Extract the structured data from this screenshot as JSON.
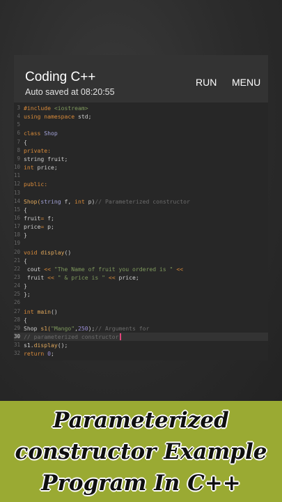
{
  "app": {
    "title": "Coding C++",
    "autosave": "Auto saved at 08:20:55",
    "run_label": "RUN",
    "menu_label": "MENU"
  },
  "editor": {
    "active_line": 30,
    "lines": [
      {
        "n": "3",
        "tokens": [
          [
            "kw",
            "#include "
          ],
          [
            "str",
            "<iostream>"
          ]
        ]
      },
      {
        "n": "4",
        "tokens": [
          [
            "kw",
            "using namespace "
          ],
          [
            "pl",
            "std;"
          ]
        ]
      },
      {
        "n": "5",
        "tokens": []
      },
      {
        "n": "6",
        "tokens": [
          [
            "kw",
            "class "
          ],
          [
            "ty",
            "Shop"
          ]
        ]
      },
      {
        "n": "7",
        "tokens": [
          [
            "pl",
            "{"
          ]
        ]
      },
      {
        "n": "8",
        "tokens": [
          [
            "kw",
            "private:"
          ]
        ]
      },
      {
        "n": "9",
        "tokens": [
          [
            "pl",
            "string fruit;"
          ]
        ]
      },
      {
        "n": "10",
        "tokens": [
          [
            "kw",
            "int "
          ],
          [
            "pl",
            "price;"
          ]
        ]
      },
      {
        "n": "11",
        "tokens": []
      },
      {
        "n": "12",
        "tokens": [
          [
            "kw",
            "public:"
          ]
        ]
      },
      {
        "n": "13",
        "tokens": []
      },
      {
        "n": "14",
        "tokens": [
          [
            "fn",
            "Shop("
          ],
          [
            "ty",
            "string "
          ],
          [
            "pl",
            "f, "
          ],
          [
            "kw",
            "int "
          ],
          [
            "pl",
            "p)"
          ],
          [
            "cm",
            "// Parameterized constructor"
          ]
        ]
      },
      {
        "n": "15",
        "tokens": [
          [
            "pl",
            "{"
          ]
        ]
      },
      {
        "n": "16",
        "tokens": [
          [
            "pl",
            "fruit"
          ],
          [
            "op",
            "= "
          ],
          [
            "pl",
            "f;"
          ]
        ]
      },
      {
        "n": "17",
        "tokens": [
          [
            "pl",
            "price"
          ],
          [
            "op",
            "= "
          ],
          [
            "pl",
            "p;"
          ]
        ]
      },
      {
        "n": "18",
        "tokens": [
          [
            "pl",
            "}"
          ]
        ]
      },
      {
        "n": "19",
        "tokens": []
      },
      {
        "n": "20",
        "tokens": [
          [
            "kw",
            "void "
          ],
          [
            "fn",
            "display"
          ],
          [
            "pl",
            "()"
          ]
        ]
      },
      {
        "n": "21",
        "tokens": [
          [
            "pl",
            "{"
          ]
        ]
      },
      {
        "n": "22",
        "tokens": [
          [
            "pl",
            " cout "
          ],
          [
            "op",
            "<< "
          ],
          [
            "str",
            "\"The Name of fruit you ordered is \" "
          ],
          [
            "op",
            "<<"
          ]
        ]
      },
      {
        "n": "23",
        "tokens": [
          [
            "pl",
            " fruit "
          ],
          [
            "op",
            "<< "
          ],
          [
            "str",
            "\" & price is \" "
          ],
          [
            "op",
            "<< "
          ],
          [
            "pl",
            "price;"
          ]
        ]
      },
      {
        "n": "24",
        "tokens": [
          [
            "pl",
            "}"
          ]
        ]
      },
      {
        "n": "25",
        "tokens": [
          [
            "pl",
            "};"
          ]
        ]
      },
      {
        "n": "26",
        "tokens": []
      },
      {
        "n": "27",
        "tokens": [
          [
            "kw",
            "int "
          ],
          [
            "fn",
            "main"
          ],
          [
            "pl",
            "()"
          ]
        ]
      },
      {
        "n": "28",
        "tokens": [
          [
            "pl",
            "{"
          ]
        ]
      },
      {
        "n": "29",
        "tokens": [
          [
            "pl",
            "Shop "
          ],
          [
            "fn",
            "s1("
          ],
          [
            "str",
            "\"Mango\""
          ],
          [
            "pl",
            ","
          ],
          [
            "num",
            "250"
          ],
          [
            "pl",
            ");"
          ],
          [
            "cm",
            "// Arguments for"
          ]
        ]
      },
      {
        "n": "30",
        "tokens": [
          [
            "cm",
            "// parameterized constructor"
          ]
        ]
      },
      {
        "n": "31",
        "tokens": [
          [
            "pl",
            "s1."
          ],
          [
            "fn",
            "display"
          ],
          [
            "pl",
            "();"
          ]
        ]
      },
      {
        "n": "32",
        "tokens": [
          [
            "kw",
            "return "
          ],
          [
            "num",
            "0"
          ],
          [
            "pl",
            ";"
          ]
        ]
      }
    ]
  },
  "banner": {
    "lines": [
      "Parameterized",
      "constructor Example",
      "Program In C++"
    ],
    "background": "#9aaa33"
  }
}
